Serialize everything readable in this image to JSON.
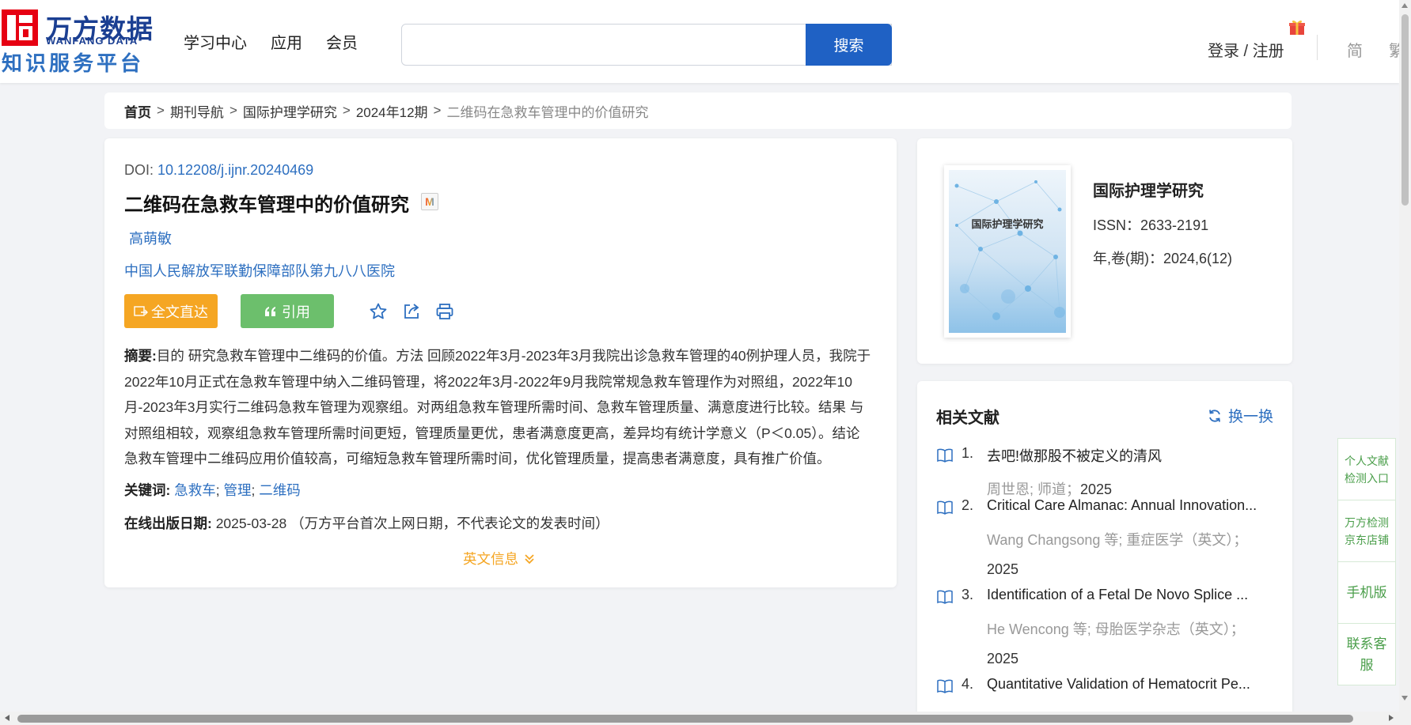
{
  "logo": {
    "title": "万方数据",
    "subtitle": "WANFANG DATA",
    "platform": "知识服务平台",
    "brand_red": "#e60012",
    "brand_blue": "#1b3f92"
  },
  "nav": [
    "学习中心",
    "应用",
    "会员"
  ],
  "search": {
    "value": "",
    "button": "搜索"
  },
  "header_right": {
    "login": "登录 / 注册",
    "lang_simplified": "简",
    "lang_traditional": "繁"
  },
  "breadcrumb": {
    "home": "首页",
    "sep": ">",
    "items": [
      "期刊导航",
      "国际护理学研究",
      "2024年12期"
    ],
    "current": "二维码在急救车管理中的价值研究"
  },
  "article": {
    "doi_label": "DOI: ",
    "doi": "10.12208/j.ijnr.20240469",
    "title": "二维码在急救车管理中的价值研究",
    "badge": "M",
    "author": "高萌敏",
    "org": "中国人民解放军联勤保障部队第九八八医院",
    "btn_fulltext": "全文直达",
    "btn_cite": "引用",
    "abstract_label": "摘要:",
    "abstract": "目的 研究急救车管理中二维码的价值。方法 回顾2022年3月-2023年3月我院出诊急救车管理的40例护理人员，我院于2022年10月正式在急救车管理中纳入二维码管理，将2022年3月-2022年9月我院常规急救车管理作为对照组，2022年10月-2023年3月实行二维码急救车管理为观察组。对两组急救车管理所需时间、急救车管理质量、满意度进行比较。结果 与对照组相较，观察组急救车管理所需时间更短，管理质量更优，患者满意度更高，差异均有统计学意义（P＜0.05）。结论 急救车管理中二维码应用价值较高，可缩短急救车管理所需时间，优化管理质量，提高患者满意度，具有推广价值。",
    "keywords_label": "关键词:",
    "keywords": [
      "急救车",
      "管理",
      "二维码"
    ],
    "keyword_sep": ";",
    "pubdate_label": "在线出版日期:",
    "pubdate": "2025-03-28",
    "pubdate_note": "（万方平台首次上网日期，不代表论文的发表时间）",
    "en_info": "英文信息"
  },
  "journal": {
    "cover_title": "国际护理学研究",
    "name": "国际护理学研究",
    "issn": "ISSN：2633-2191",
    "volume": "年,卷(期)：2024,6(12)"
  },
  "related": {
    "heading": "相关文献",
    "refresh": "换一换",
    "items": [
      {
        "num": "1.",
        "title": "去吧!做那股不被定义的清风",
        "meta": "周世恩; 师道；",
        "year": "2025"
      },
      {
        "num": "2.",
        "title": "Critical Care Almanac: Annual Innovation...",
        "meta": "Wang Changsong  等;  重症医学（英文）；",
        "year": "2025"
      },
      {
        "num": "3.",
        "title": "Identification of a Fetal De Novo Splice ...",
        "meta": "He Wencong  等;  母胎医学杂志（英文）；",
        "year": "2025"
      },
      {
        "num": "4.",
        "title": "Quantitative Validation of Hematocrit Pe...",
        "meta": "",
        "year": ""
      }
    ]
  },
  "float_tools": {
    "personal_check": "个人文献检测入口",
    "jd_store": "万方检测京东店铺",
    "mobile": "手机版",
    "contact": "联系客服"
  },
  "colors": {
    "link_blue": "#2d6fc0",
    "search_blue": "#1f61c4",
    "fulltext_orange": "#f5a623",
    "cite_green": "#6cbf6c",
    "tool_green": "#4a9e4a"
  }
}
